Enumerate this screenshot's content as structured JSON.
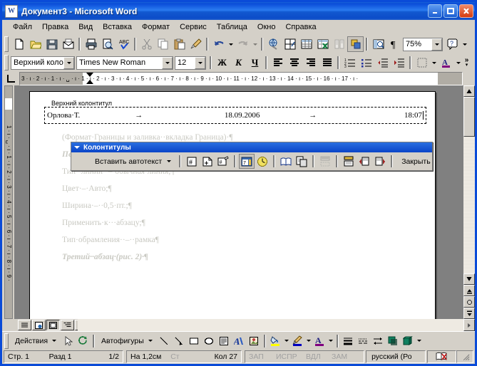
{
  "window": {
    "title": "Документ3 - Microsoft Word",
    "app_icon": "word-document-icon",
    "minimize_label": "_",
    "maximize_label": "□",
    "close_label": "✕",
    "titlebar_color": "#0a4bd8",
    "face_color": "#d4d0c8"
  },
  "menu": {
    "items": [
      {
        "label": "Файл"
      },
      {
        "label": "Правка"
      },
      {
        "label": "Вид"
      },
      {
        "label": "Вставка"
      },
      {
        "label": "Формат"
      },
      {
        "label": "Сервис"
      },
      {
        "label": "Таблица"
      },
      {
        "label": "Окно"
      },
      {
        "label": "Справка"
      }
    ]
  },
  "standard_toolbar": {
    "buttons": [
      {
        "name": "new-document-icon"
      },
      {
        "name": "open-folder-icon"
      },
      {
        "name": "save-icon"
      },
      {
        "name": "email-icon"
      },
      {
        "name": "print-icon"
      },
      {
        "name": "print-preview-icon"
      },
      {
        "name": "spellcheck-icon"
      },
      {
        "name": "cut-scissors-icon"
      },
      {
        "name": "copy-icon"
      },
      {
        "name": "paste-icon"
      },
      {
        "name": "format-painter-icon"
      },
      {
        "name": "undo-icon"
      },
      {
        "name": "redo-icon"
      },
      {
        "name": "insert-hyperlink-icon"
      },
      {
        "name": "tables-and-borders-icon"
      },
      {
        "name": "insert-table-icon"
      },
      {
        "name": "insert-excel-sheet-icon"
      },
      {
        "name": "columns-icon"
      },
      {
        "name": "drawing-icon"
      },
      {
        "name": "document-map-icon"
      },
      {
        "name": "show-formatting-marks-icon"
      },
      {
        "name": "help-icon"
      }
    ],
    "zoom_value": "75%"
  },
  "formatting_toolbar": {
    "style_value": "Верхний колонт",
    "font_value": "Times New Roman",
    "size_value": "12",
    "bold_label": "Ж",
    "italic_label": "К",
    "underline_label": "Ч",
    "buttons": [
      {
        "name": "align-left-icon"
      },
      {
        "name": "align-center-icon"
      },
      {
        "name": "align-right-icon"
      },
      {
        "name": "align-justify-icon"
      },
      {
        "name": "numbered-list-icon"
      },
      {
        "name": "bulleted-list-icon"
      },
      {
        "name": "decrease-indent-icon"
      },
      {
        "name": "increase-indent-icon"
      },
      {
        "name": "borders-icon"
      },
      {
        "name": "font-color-icon"
      },
      {
        "name": "toolbar-overflow-icon"
      }
    ]
  },
  "ruler": {
    "horizontal_ticks": "3 · ı · 2 · ı · 1 · ı · ␣ · ı · 1 · ı · 2 · ı · 3 · ı · 4 · ı · 5 · ı · 6 · ı · 7 · ı · 8 · ı · 9 · ı · 10 · ı · 11 · ı · 12 · ı · 13 · ı · 14 · ı · 15 · ı · 16 · ı · 17 · ı ·",
    "vertical_ticks": "1 · ı · ␣ · ı · 1 · ı · 2 · ı · 3 · ı · 4 · ı · 5 · ı · 6 · ı · 7 · ı · 8 · ı · 9 ·",
    "tab_stop_label": "L"
  },
  "document": {
    "header_label": "Верхний колонтитул",
    "header_left": "Орлова·Т.",
    "header_center": "18.09.2006",
    "header_right": "18:07",
    "tab_arrow": "→",
    "body_lines": [
      "(Формат·Границы и заливка··вкладка Граница)·¶",
      "Первый·абзац:¶",
      "Тип··линии··–·обычная·линия;¶",
      "Цвет·–·Авто;¶",
      "Ширина·–··0,5·пт.;¶",
      "Применить·к···абзацу;¶",
      "Тип·обрамления··–··рамка¶",
      "Третий··абзац·(рис. 2)·¶"
    ]
  },
  "header_footer_toolbar": {
    "title": "Колонтитулы",
    "autotext_label": "Вставить автотекст",
    "close_label": "Закрыть",
    "buttons": [
      {
        "name": "insert-page-number-icon"
      },
      {
        "name": "insert-number-of-pages-icon"
      },
      {
        "name": "format-page-number-icon"
      },
      {
        "name": "insert-date-icon"
      },
      {
        "name": "insert-time-icon"
      },
      {
        "name": "page-setup-icon"
      },
      {
        "name": "show-hide-document-text-icon"
      },
      {
        "name": "same-as-previous-icon"
      },
      {
        "name": "switch-header-footer-icon"
      },
      {
        "name": "show-previous-icon"
      },
      {
        "name": "show-next-icon"
      }
    ]
  },
  "view_buttons": [
    {
      "name": "normal-view-icon"
    },
    {
      "name": "web-layout-view-icon"
    },
    {
      "name": "print-layout-view-icon"
    },
    {
      "name": "outline-view-icon"
    },
    {
      "name": "scroll-left-icon"
    }
  ],
  "drawing_toolbar": {
    "actions_label": "Действия",
    "autoshapes_label": "Автофигуры",
    "buttons": [
      {
        "name": "select-objects-icon"
      },
      {
        "name": "free-rotate-icon"
      },
      {
        "name": "line-icon"
      },
      {
        "name": "arrow-icon"
      },
      {
        "name": "rectangle-icon"
      },
      {
        "name": "oval-icon"
      },
      {
        "name": "text-box-icon"
      },
      {
        "name": "wordart-icon"
      },
      {
        "name": "insert-picture-icon"
      },
      {
        "name": "fill-color-icon"
      },
      {
        "name": "line-color-icon"
      },
      {
        "name": "font-color-icon"
      },
      {
        "name": "line-style-icon"
      },
      {
        "name": "dash-style-icon"
      },
      {
        "name": "arrow-style-icon"
      },
      {
        "name": "shadow-icon"
      },
      {
        "name": "3d-icon"
      }
    ]
  },
  "status_bar": {
    "page": "Стр. 1",
    "section": "Разд 1",
    "page_of": "1/2",
    "at": "На 1,2см",
    "line": "Ст",
    "column": "Кол 27",
    "rec": "ЗАП",
    "trk": "ИСПР",
    "ext": "ВДЛ",
    "ovr": "ЗАМ",
    "language": "русский (Ро",
    "spell_icon": "spelling-status-icon"
  }
}
